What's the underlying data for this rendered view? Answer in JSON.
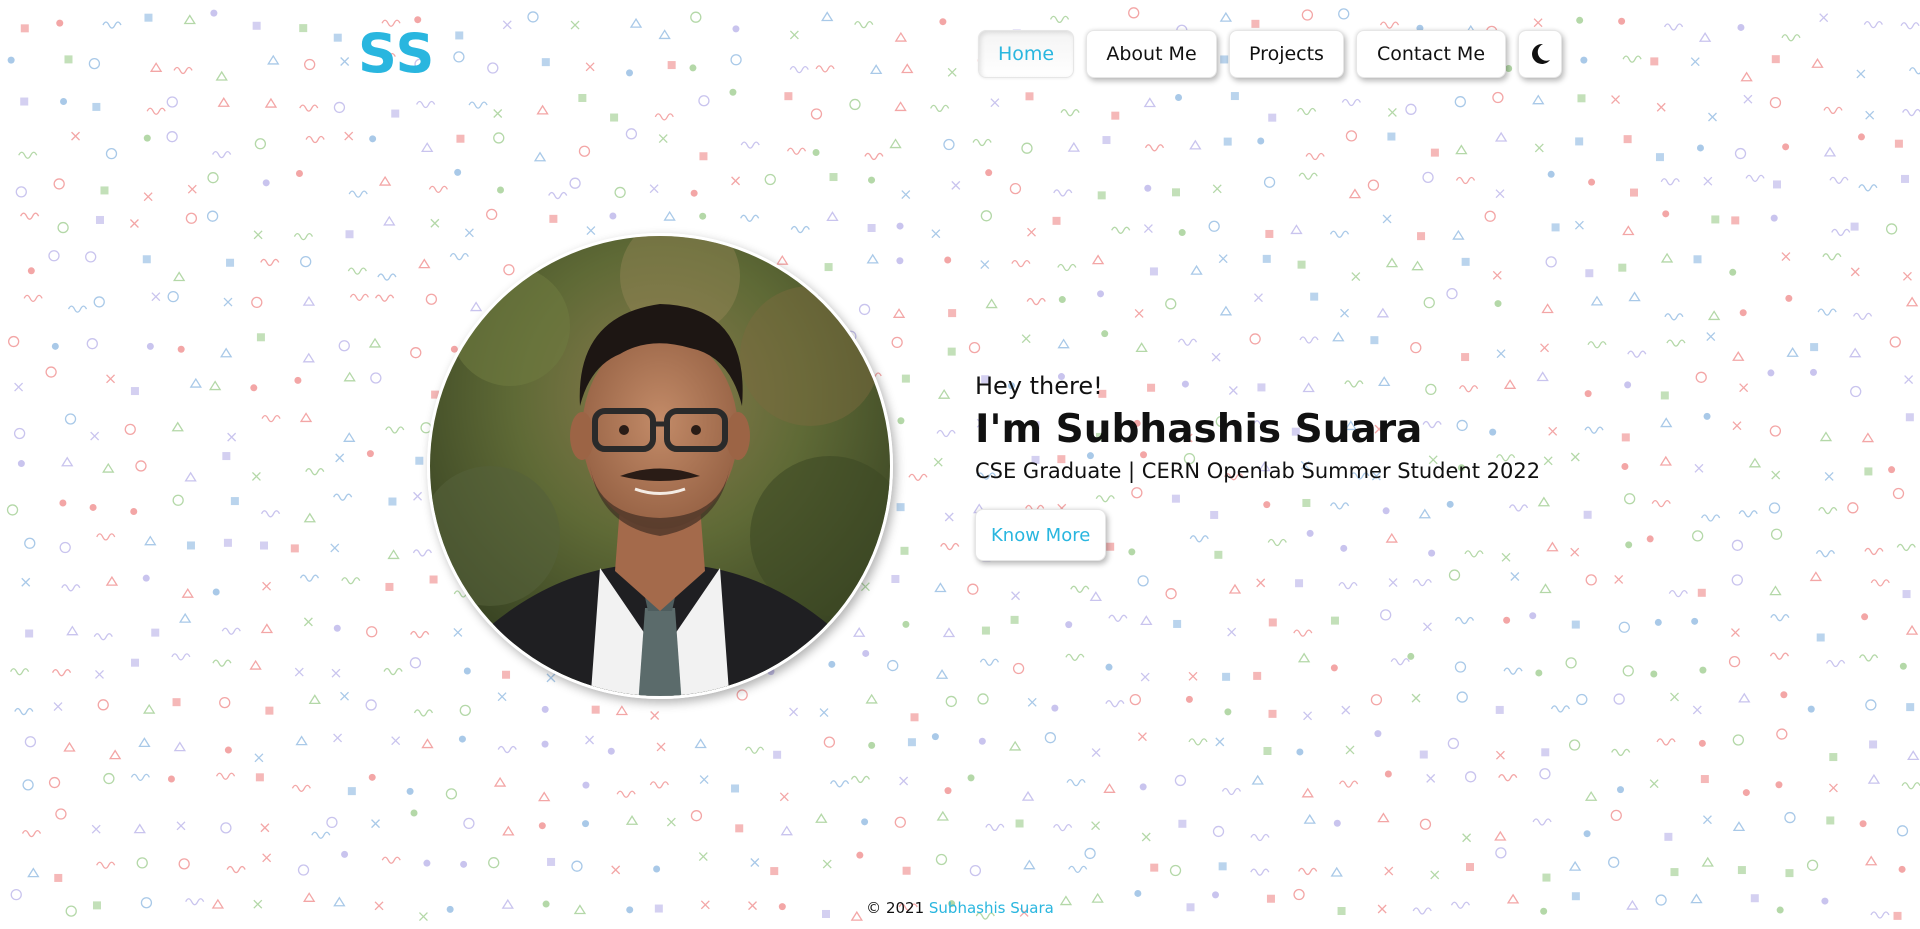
{
  "colors": {
    "accent": "#29b6df",
    "text": "#111111",
    "background": "#ffffff",
    "pattern": [
      "#f3a6a6",
      "#a9c9e8",
      "#b4d8a8",
      "#c9c4ee",
      "#d6d6d6"
    ]
  },
  "logo": {
    "text": "SS"
  },
  "nav": {
    "items": [
      {
        "label": "Home",
        "active": true
      },
      {
        "label": "About Me",
        "active": false
      },
      {
        "label": "Projects",
        "active": false
      },
      {
        "label": "Contact Me",
        "active": false
      }
    ],
    "theme_toggle_icon": "moon-icon"
  },
  "hero": {
    "greeting": "Hey there!",
    "name": "I'm Subhashis Suara",
    "subtitle": "CSE Graduate | CERN Openlab Summer Student 2022",
    "cta_label": "Know More"
  },
  "footer": {
    "copyright": "© 2021",
    "author": "Subhashis Suara"
  }
}
